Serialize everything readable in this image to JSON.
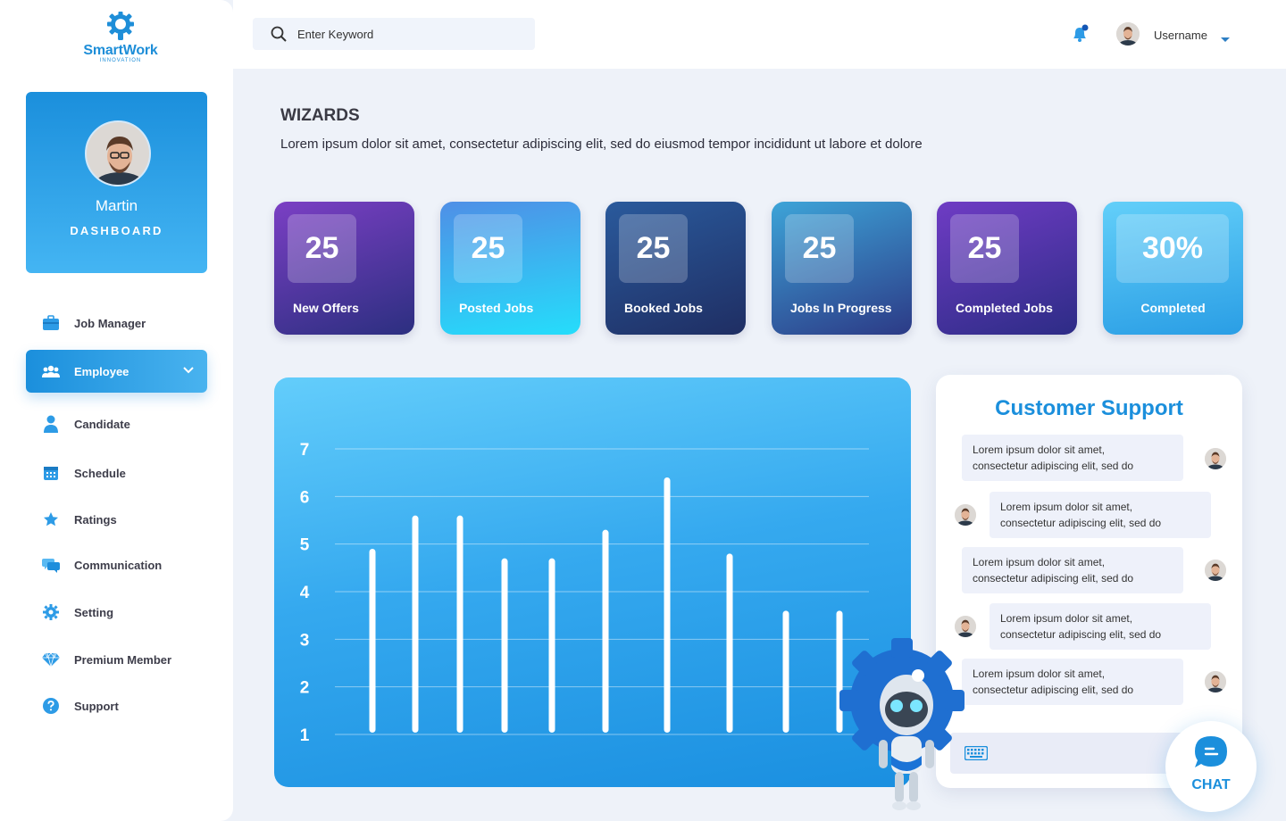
{
  "brand": {
    "name": "SmartWork",
    "tagline": "INNOVATION"
  },
  "profile": {
    "name": "Martin",
    "role": "DASHBOARD"
  },
  "nav": [
    {
      "label": "Job Manager",
      "icon": "briefcase-icon"
    },
    {
      "label": "Employee",
      "icon": "group-icon",
      "active": true
    },
    {
      "label": "Candidate",
      "icon": "user-icon"
    },
    {
      "label": "Schedule",
      "icon": "calendar-icon"
    },
    {
      "label": "Ratings",
      "icon": "star-icon"
    },
    {
      "label": "Communication",
      "icon": "chat-bubbles-icon"
    },
    {
      "label": "Setting",
      "icon": "gear-icon"
    },
    {
      "label": "Premium Member",
      "icon": "diamond-icon"
    },
    {
      "label": "Support",
      "icon": "question-icon"
    }
  ],
  "search": {
    "placeholder": "Enter Keyword"
  },
  "user": {
    "name": "Username"
  },
  "page": {
    "title": "WIZARDS",
    "description": "Lorem ipsum dolor sit amet, consectetur adipiscing elit, sed do eiusmod tempor incididunt ut labore et dolore"
  },
  "stats": [
    {
      "value": "25",
      "label": "New Offers"
    },
    {
      "value": "25",
      "label": "Posted Jobs"
    },
    {
      "value": "25",
      "label": "Booked Jobs"
    },
    {
      "value": "25",
      "label": "Jobs In Progress"
    },
    {
      "value": "25",
      "label": "Completed Jobs"
    },
    {
      "value": "30%",
      "label": "Completed"
    }
  ],
  "chart_data": {
    "type": "bar",
    "title": "",
    "xlabel": "",
    "ylabel": "",
    "yticks": [
      "1",
      "2",
      "3",
      "4",
      "5",
      "6",
      "7"
    ],
    "ylim": [
      1,
      7
    ],
    "grid": true,
    "values": [
      4.9,
      5.6,
      5.6,
      4.7,
      4.7,
      5.3,
      6.4,
      4.8,
      3.6,
      3.6
    ]
  },
  "support": {
    "title": "Customer Support",
    "messages": [
      {
        "text1": "Lorem ipsum dolor sit amet,",
        "text2": "consectetur adipiscing elit, sed do",
        "side": "right"
      },
      {
        "text1": "Lorem ipsum dolor sit amet,",
        "text2": "consectetur adipiscing elit, sed do",
        "side": "left"
      },
      {
        "text1": "Lorem ipsum dolor sit amet,",
        "text2": "consectetur adipiscing elit, sed do",
        "side": "right"
      },
      {
        "text1": "Lorem ipsum dolor sit amet,",
        "text2": "consectetur adipiscing elit, sed do",
        "side": "left"
      },
      {
        "text1": "Lorem ipsum dolor sit amet,",
        "text2": "consectetur adipiscing elit, sed do",
        "side": "right"
      }
    ],
    "chat_label": "CHAT"
  },
  "colors": {
    "accent": "#1b8fdc",
    "card_gradients": [
      [
        "#7b3fc4",
        "#2c2f80"
      ],
      [
        "#4fa0e8",
        "#25ddfb"
      ],
      [
        "#2a5a9c",
        "#1f2e63"
      ],
      [
        "#3da4d8",
        "#2c3a86"
      ],
      [
        "#6f3cc4",
        "#2d2c86"
      ],
      [
        "#63cff9",
        "#2a9ee5"
      ]
    ]
  }
}
